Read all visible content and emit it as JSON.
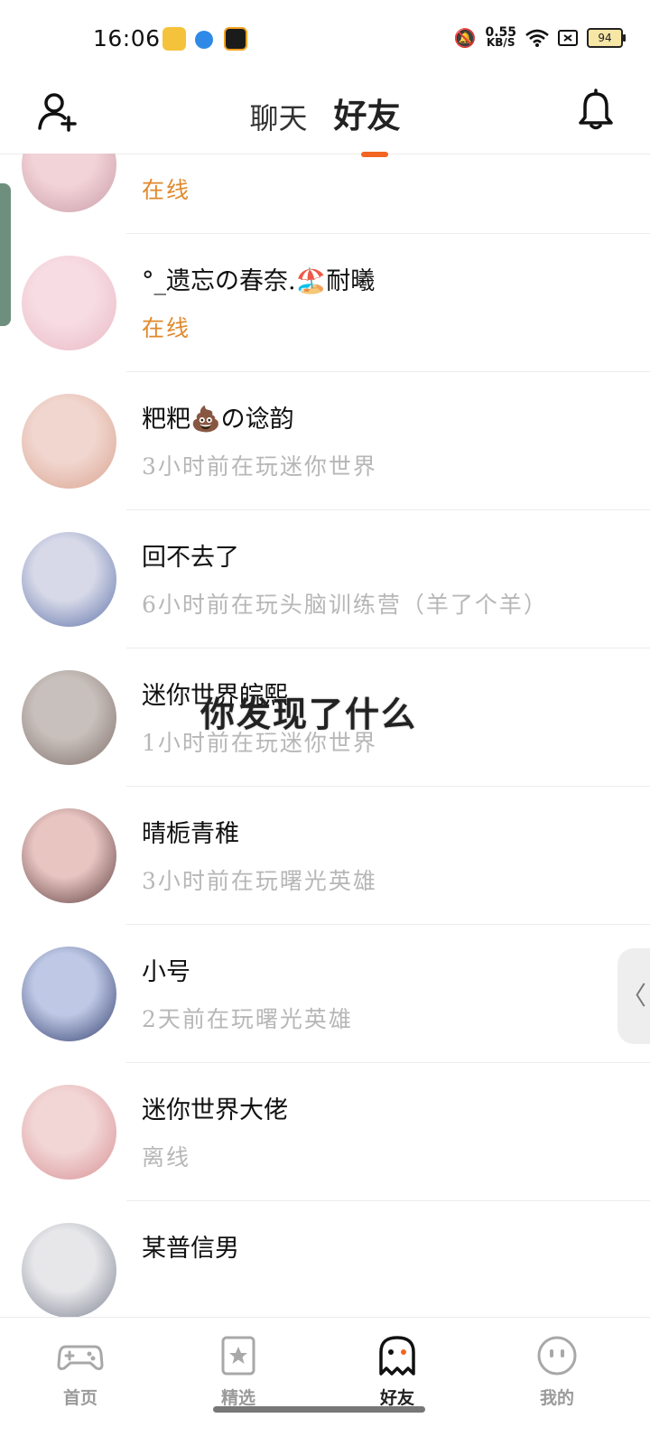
{
  "status_bar": {
    "time": "16:06",
    "speed_value": "0.55",
    "speed_unit": "KB/S",
    "battery": "94"
  },
  "header": {
    "tabs": [
      "聊天",
      "好友"
    ],
    "active_tab": "好友"
  },
  "friends": [
    {
      "name": "",
      "status": "在线",
      "online": true,
      "avatar_colors": [
        "#f2d3d8",
        "#c99aa6"
      ]
    },
    {
      "name": "°_遗忘の春奈.🏖️耐曦",
      "status": "在线",
      "online": true,
      "avatar_colors": [
        "#f7dce3",
        "#e9b8c4"
      ]
    },
    {
      "name": "粑粑💩の谂韵",
      "status": "3小时前在玩迷你世界",
      "online": false,
      "avatar_colors": [
        "#f1d6cf",
        "#d9a38f"
      ]
    },
    {
      "name": "回不去了",
      "status": "6小时前在玩头脑训练营（羊了个羊）",
      "online": false,
      "avatar_colors": [
        "#d7d9e8",
        "#5b6fa8"
      ]
    },
    {
      "name": "迷你世界皖熙",
      "status": "1小时前在玩迷你世界",
      "online": false,
      "avatar_colors": [
        "#c8c0bc",
        "#7f6e69"
      ]
    },
    {
      "name": "晴栀青稚",
      "status": "3小时前在玩曙光英雄",
      "online": false,
      "avatar_colors": [
        "#e9c5c2",
        "#5a3d3d"
      ]
    },
    {
      "name": "小号",
      "status": "2天前在玩曙光英雄",
      "online": false,
      "avatar_colors": [
        "#bfc9e6",
        "#2f3b6b"
      ]
    },
    {
      "name": "迷你世界大佬",
      "status": "离线",
      "online": false,
      "avatar_colors": [
        "#f2d5d5",
        "#d78f93"
      ]
    },
    {
      "name": "某普信男",
      "status": "",
      "online": false,
      "avatar_colors": [
        "#e7e7ea",
        "#7a7f8f"
      ]
    }
  ],
  "overlay_text": "你发现了什么",
  "side_tab_glyph": "〈",
  "bottom_nav": [
    {
      "label": "首页",
      "icon": "gamepad-icon"
    },
    {
      "label": "精选",
      "icon": "star-badge-icon"
    },
    {
      "label": "好友",
      "icon": "ghost-icon",
      "active": true
    },
    {
      "label": "我的",
      "icon": "face-icon"
    }
  ],
  "colors": {
    "accent": "#f26522",
    "online": "#e08a2e"
  }
}
